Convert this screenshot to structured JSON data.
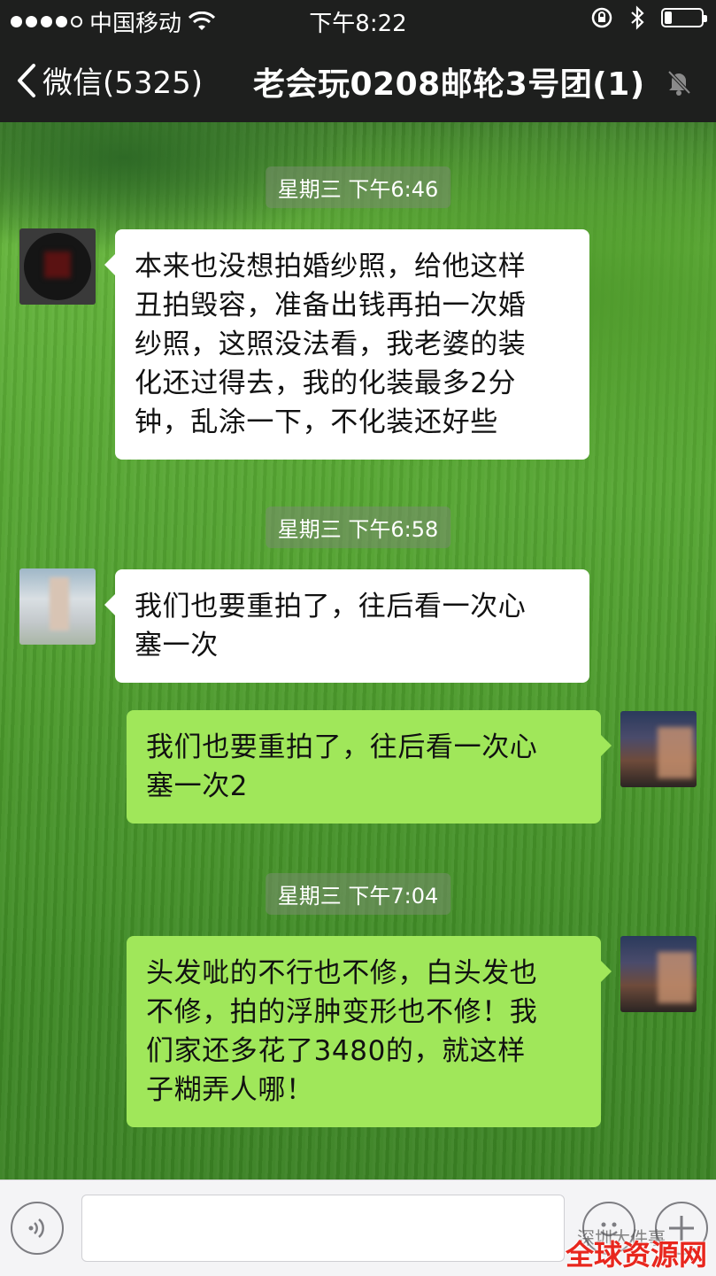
{
  "status_bar": {
    "carrier": "中国移动",
    "time": "下午8:22",
    "battery_level": 0.2
  },
  "nav": {
    "back_label": "微信(5325)",
    "title": "老会玩0208邮轮3号团(1)"
  },
  "timestamps": [
    "星期三 下午6:46",
    "星期三 下午6:58",
    "星期三 下午7:04"
  ],
  "messages": [
    {
      "side": "left",
      "lines": [
        "本来也没想拍婚纱照，给他这样",
        "丑拍毁容，准备出钱再拍一次婚",
        "纱照，这照没法看，我老婆的装",
        "化还过得去，我的化装最多2分",
        "钟，乱涂一下，不化装还好些"
      ]
    },
    {
      "side": "left",
      "lines": [
        "我们也要重拍了，往后看一次心",
        "塞一次"
      ]
    },
    {
      "side": "right",
      "lines": [
        "我们也要重拍了，往后看一次心",
        "塞一次2"
      ]
    },
    {
      "side": "right",
      "lines": [
        "头发呲的不行也不修，白头发也",
        "不修，拍的浮肿变形也不修！我",
        "们家还多花了3480的，就这样",
        "子糊弄人哪！"
      ]
    }
  ],
  "watermark": {
    "account": "深圳大件事",
    "site": "全球资源网"
  },
  "colors": {
    "bar_dark": "#1e1f1e",
    "bubble_self": "#a0e75a",
    "bubble_other": "#ffffff",
    "watermark_red": "#e8261d"
  },
  "icons": [
    "wifi-icon",
    "lock-rotation-icon",
    "bluetooth-icon",
    "battery-icon",
    "back-chevron-icon",
    "mute-bell-icon",
    "voice-icon",
    "emoji-icon",
    "plus-icon"
  ]
}
